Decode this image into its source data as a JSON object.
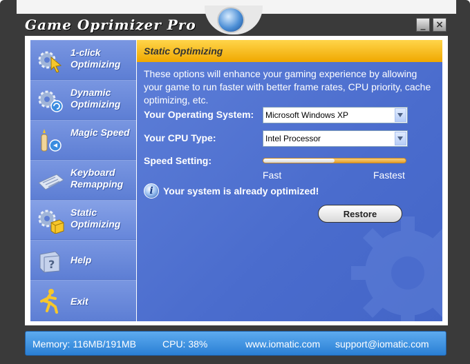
{
  "app": {
    "title": "Game Oprimizer Pro"
  },
  "window_controls": {
    "minimize": "_",
    "close": "×"
  },
  "sidebar": {
    "items": [
      {
        "label": "1-click Optimizing",
        "icon": "gear-cursor-icon"
      },
      {
        "label": "Dynamic Optimizing",
        "icon": "gear-refresh-icon"
      },
      {
        "label": "Magic Speed",
        "icon": "magic-speed-icon"
      },
      {
        "label": "Keyboard Remapping",
        "icon": "keyboard-icon"
      },
      {
        "label": "Static Optimizing",
        "icon": "gear-box-icon"
      },
      {
        "label": "Help",
        "icon": "help-book-icon"
      },
      {
        "label": "Exit",
        "icon": "running-man-icon"
      }
    ],
    "selected_index": 4
  },
  "panel": {
    "title": "Static Optimizing",
    "description": "These options will enhance your gaming experience by allowing your game to run faster with better frame rates, CPU priority, cache optimizing, etc.",
    "os_label": "Your Operating System:",
    "os_value": "Microsoft Windows XP",
    "cpu_label": "Your CPU Type:",
    "cpu_value": "Intel Processor",
    "speed_label": "Speed Setting:",
    "speed_min_label": "Fast",
    "speed_max_label": "Fastest",
    "speed_level_fraction": 0.5,
    "status_message": "Your system is already optimized!",
    "restore_label": "Restore"
  },
  "statusbar": {
    "memory": "Memory:  116MB/191MB",
    "cpu": "CPU:  38%",
    "website": "www.iomatic.com",
    "email": "support@iomatic.com"
  },
  "colors": {
    "panel_bg": "#4f70cf",
    "header_yellow": "#f6bf16",
    "sidebar_bg": "#6a89d8",
    "statusbar_bg": "#3b90e0"
  }
}
